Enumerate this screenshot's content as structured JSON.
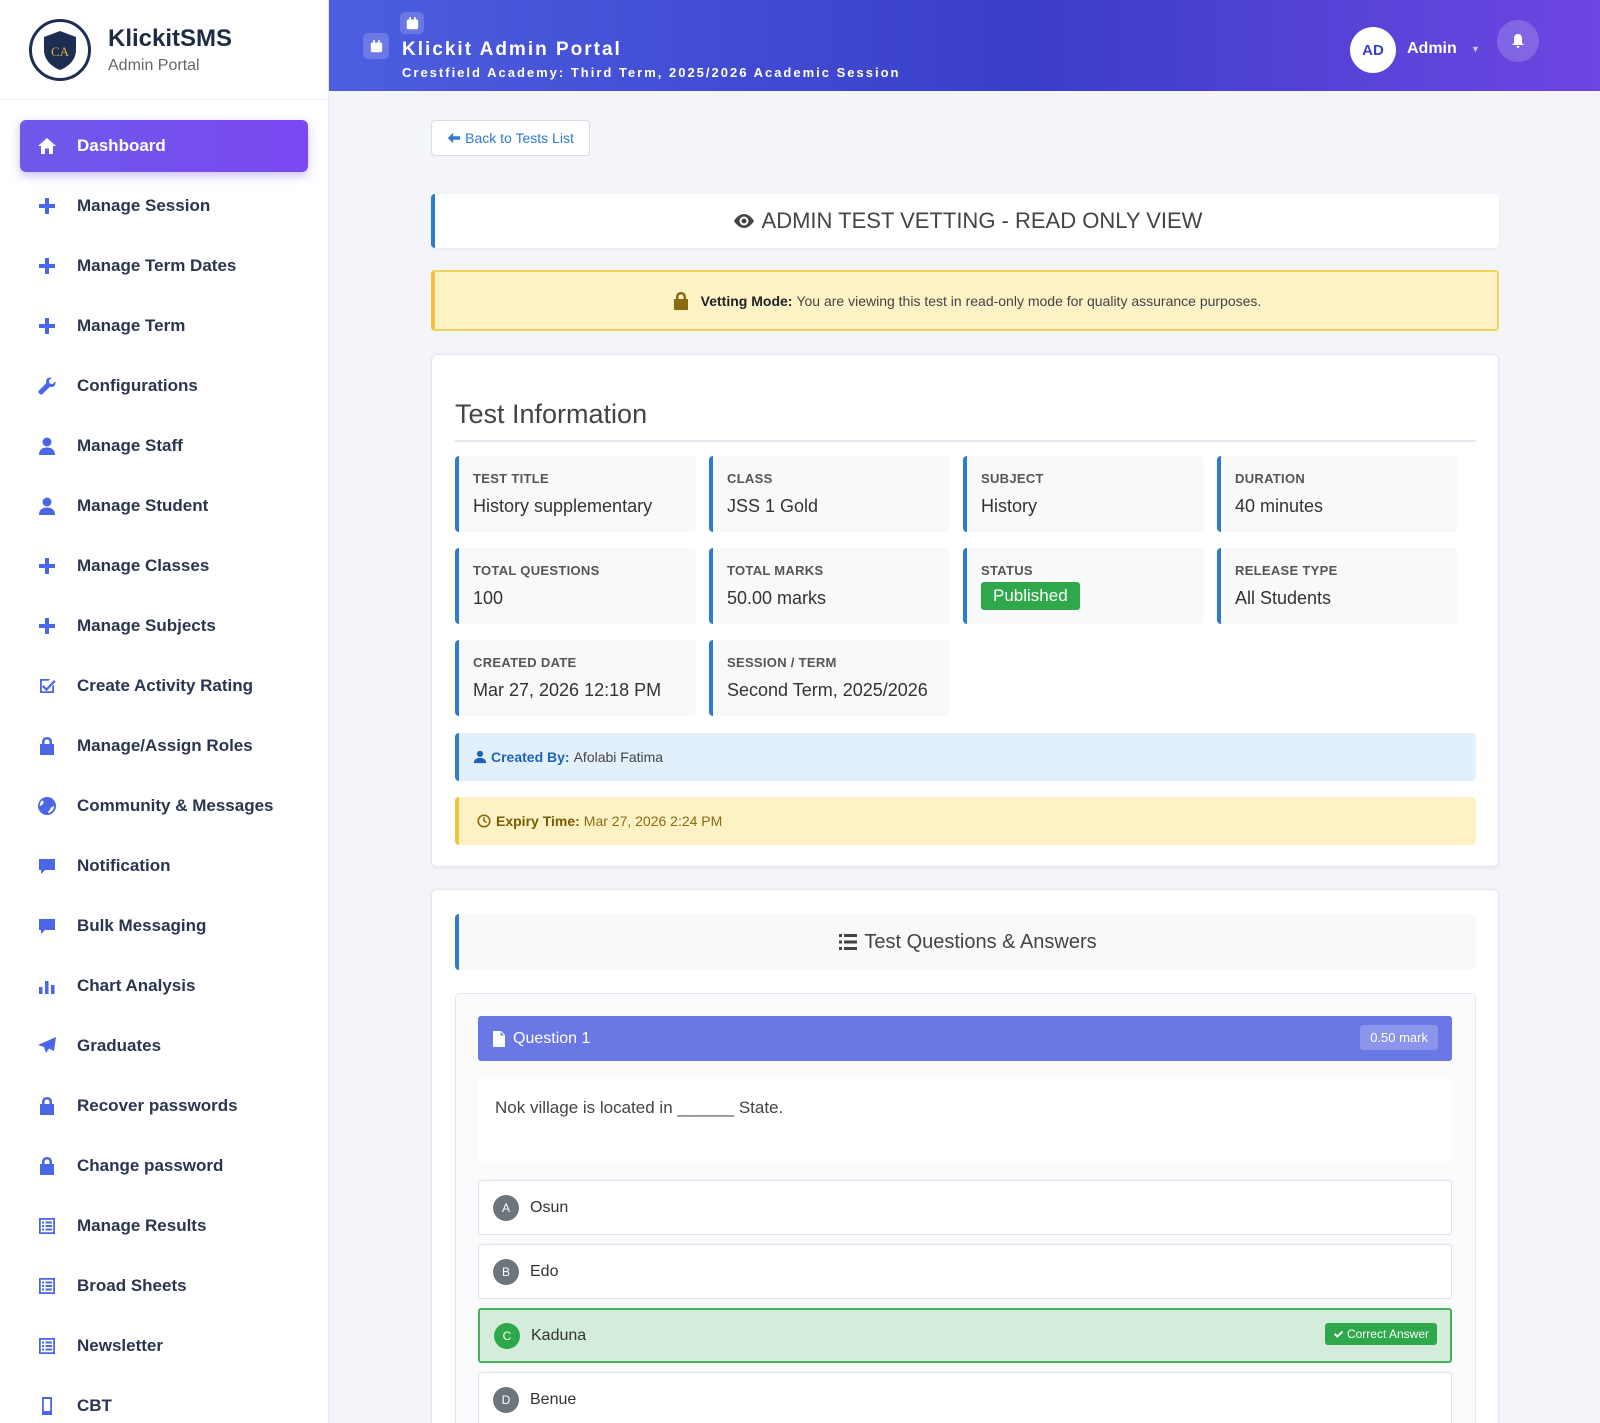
{
  "brand": {
    "name": "KlickitSMS",
    "subtitle": "Admin Portal",
    "logo_text": "CA"
  },
  "sidebar": {
    "items": [
      {
        "label": "Dashboard",
        "icon": "home-icon",
        "active": true
      },
      {
        "label": "Manage Session",
        "icon": "plus-icon"
      },
      {
        "label": "Manage Term Dates",
        "icon": "plus-icon"
      },
      {
        "label": "Manage Term",
        "icon": "plus-icon"
      },
      {
        "label": "Configurations",
        "icon": "wrench-icon"
      },
      {
        "label": "Manage Staff",
        "icon": "user-icon"
      },
      {
        "label": "Manage Student",
        "icon": "user-icon"
      },
      {
        "label": "Manage Classes",
        "icon": "plus-icon"
      },
      {
        "label": "Manage Subjects",
        "icon": "plus-icon"
      },
      {
        "label": "Create Activity Rating",
        "icon": "check-square-icon"
      },
      {
        "label": "Manage/Assign Roles",
        "icon": "lock-icon"
      },
      {
        "label": "Community & Messages",
        "icon": "globe-icon"
      },
      {
        "label": "Notification",
        "icon": "comment-icon"
      },
      {
        "label": "Bulk Messaging",
        "icon": "comment-icon"
      },
      {
        "label": "Chart Analysis",
        "icon": "bar-chart-icon"
      },
      {
        "label": "Graduates",
        "icon": "send-icon"
      },
      {
        "label": "Recover passwords",
        "icon": "lock-icon"
      },
      {
        "label": "Change password",
        "icon": "lock-icon"
      },
      {
        "label": "Manage Results",
        "icon": "list-alt-icon"
      },
      {
        "label": "Broad Sheets",
        "icon": "list-alt-icon"
      },
      {
        "label": "Newsletter",
        "icon": "list-alt-icon"
      },
      {
        "label": "CBT",
        "icon": "mobile-icon"
      }
    ]
  },
  "header": {
    "title": "Klickit Admin Portal",
    "subtitle": "Crestfield Academy: Third Term, 2025/2026 Academic Session",
    "avatar_initials": "AD",
    "user_name": "Admin"
  },
  "back_button": "Back to Tests List",
  "vetting": {
    "heading": "ADMIN TEST VETTING - READ ONLY VIEW",
    "alert_label": "Vetting Mode:",
    "alert_text": "You are viewing this test in read-only mode for quality assurance purposes."
  },
  "test_info": {
    "title": "Test Information",
    "fields": [
      {
        "label": "TEST TITLE",
        "value": "History supplementary"
      },
      {
        "label": "CLASS",
        "value": "JSS 1 Gold"
      },
      {
        "label": "SUBJECT",
        "value": "History"
      },
      {
        "label": "DURATION",
        "value": "40 minutes"
      },
      {
        "label": "TOTAL QUESTIONS",
        "value": "100"
      },
      {
        "label": "TOTAL MARKS",
        "value": "50.00 marks"
      },
      {
        "label": "STATUS",
        "value": "Published"
      },
      {
        "label": "RELEASE TYPE",
        "value": "All Students"
      },
      {
        "label": "CREATED DATE",
        "value": "Mar 27, 2026 12:18 PM"
      },
      {
        "label": "SESSION / TERM",
        "value": "Second Term, 2025/2026"
      }
    ],
    "created_by_label": "Created By:",
    "created_by": "Afolabi Fatima",
    "expiry_label": "Expiry Time:",
    "expiry": "Mar 27, 2026 2:24 PM"
  },
  "questions": {
    "title": "Test Questions & Answers",
    "items": [
      {
        "label": "Question 1",
        "mark": "0.50 mark",
        "text": "Nok village is located in ______ State.",
        "options": [
          {
            "letter": "A",
            "text": "Osun",
            "correct": false
          },
          {
            "letter": "B",
            "text": "Edo",
            "correct": false
          },
          {
            "letter": "C",
            "text": "Kaduna",
            "correct": true
          },
          {
            "letter": "D",
            "text": "Benue",
            "correct": false
          }
        ],
        "correct_label": "Correct Answer"
      }
    ]
  },
  "colors": {
    "accent": "#2f7bd0",
    "header_start": "#4c5fe0",
    "header_end": "#6e46e2",
    "active_nav": "#6e59ea",
    "success": "#2ea84a"
  }
}
